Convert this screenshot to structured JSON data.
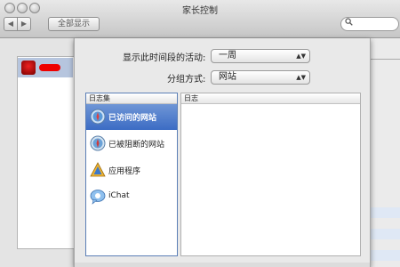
{
  "window": {
    "title": "家长控制"
  },
  "toolbar": {
    "back": "◀",
    "forward": "▶",
    "show_all": "全部显示",
    "search_icon": "🔍"
  },
  "sheet": {
    "activity_label": "显示此时间段的活动:",
    "activity_value": "一周",
    "group_label": "分组方式:",
    "group_value": "网站",
    "left_list": {
      "header": "日志集",
      "items": [
        {
          "label": "已访问的网站",
          "icon": "safari-compass-icon",
          "selected": true
        },
        {
          "label": "已被阻断的网站",
          "icon": "safari-compass-icon",
          "selected": false
        },
        {
          "label": "应用程序",
          "icon": "applications-a-icon",
          "selected": false
        },
        {
          "label": "iChat",
          "icon": "ichat-bubble-icon",
          "selected": false
        }
      ]
    },
    "right_list": {
      "header": "日志"
    }
  },
  "colors": {
    "selection": "#3c6cc4",
    "user_avatar": "#cc0000"
  }
}
